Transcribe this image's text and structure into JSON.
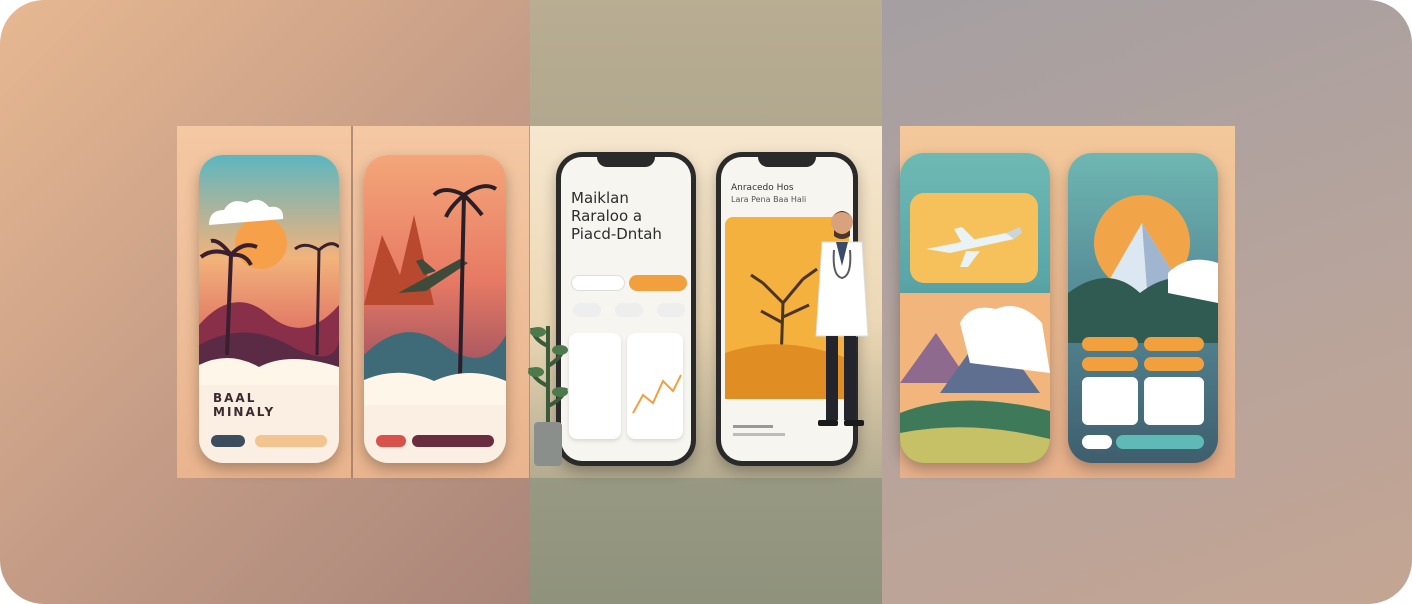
{
  "mockups": {
    "phone1": {
      "title_line1": "BAAL",
      "title_line2": "MINALY"
    },
    "phone3": {
      "headline_line1": "Maiklan",
      "headline_line2": "Raraloo a",
      "headline_line3": "Piacd-Dntah"
    },
    "phone4": {
      "header_line1": "Anracedo Hos",
      "header_line2": "Lara Pena Baa Hali"
    }
  },
  "colors": {
    "accent_orange": "#f2a03d",
    "accent_red": "#d8524a",
    "accent_teal": "#5fb9b6",
    "dark_navy": "#3c4d5e"
  },
  "icons": [
    "cloud-icon",
    "palm-tree-icon",
    "airplane-icon",
    "mountain-icon",
    "sun-icon",
    "tree-icon",
    "doctor-figure",
    "plant-icon"
  ]
}
